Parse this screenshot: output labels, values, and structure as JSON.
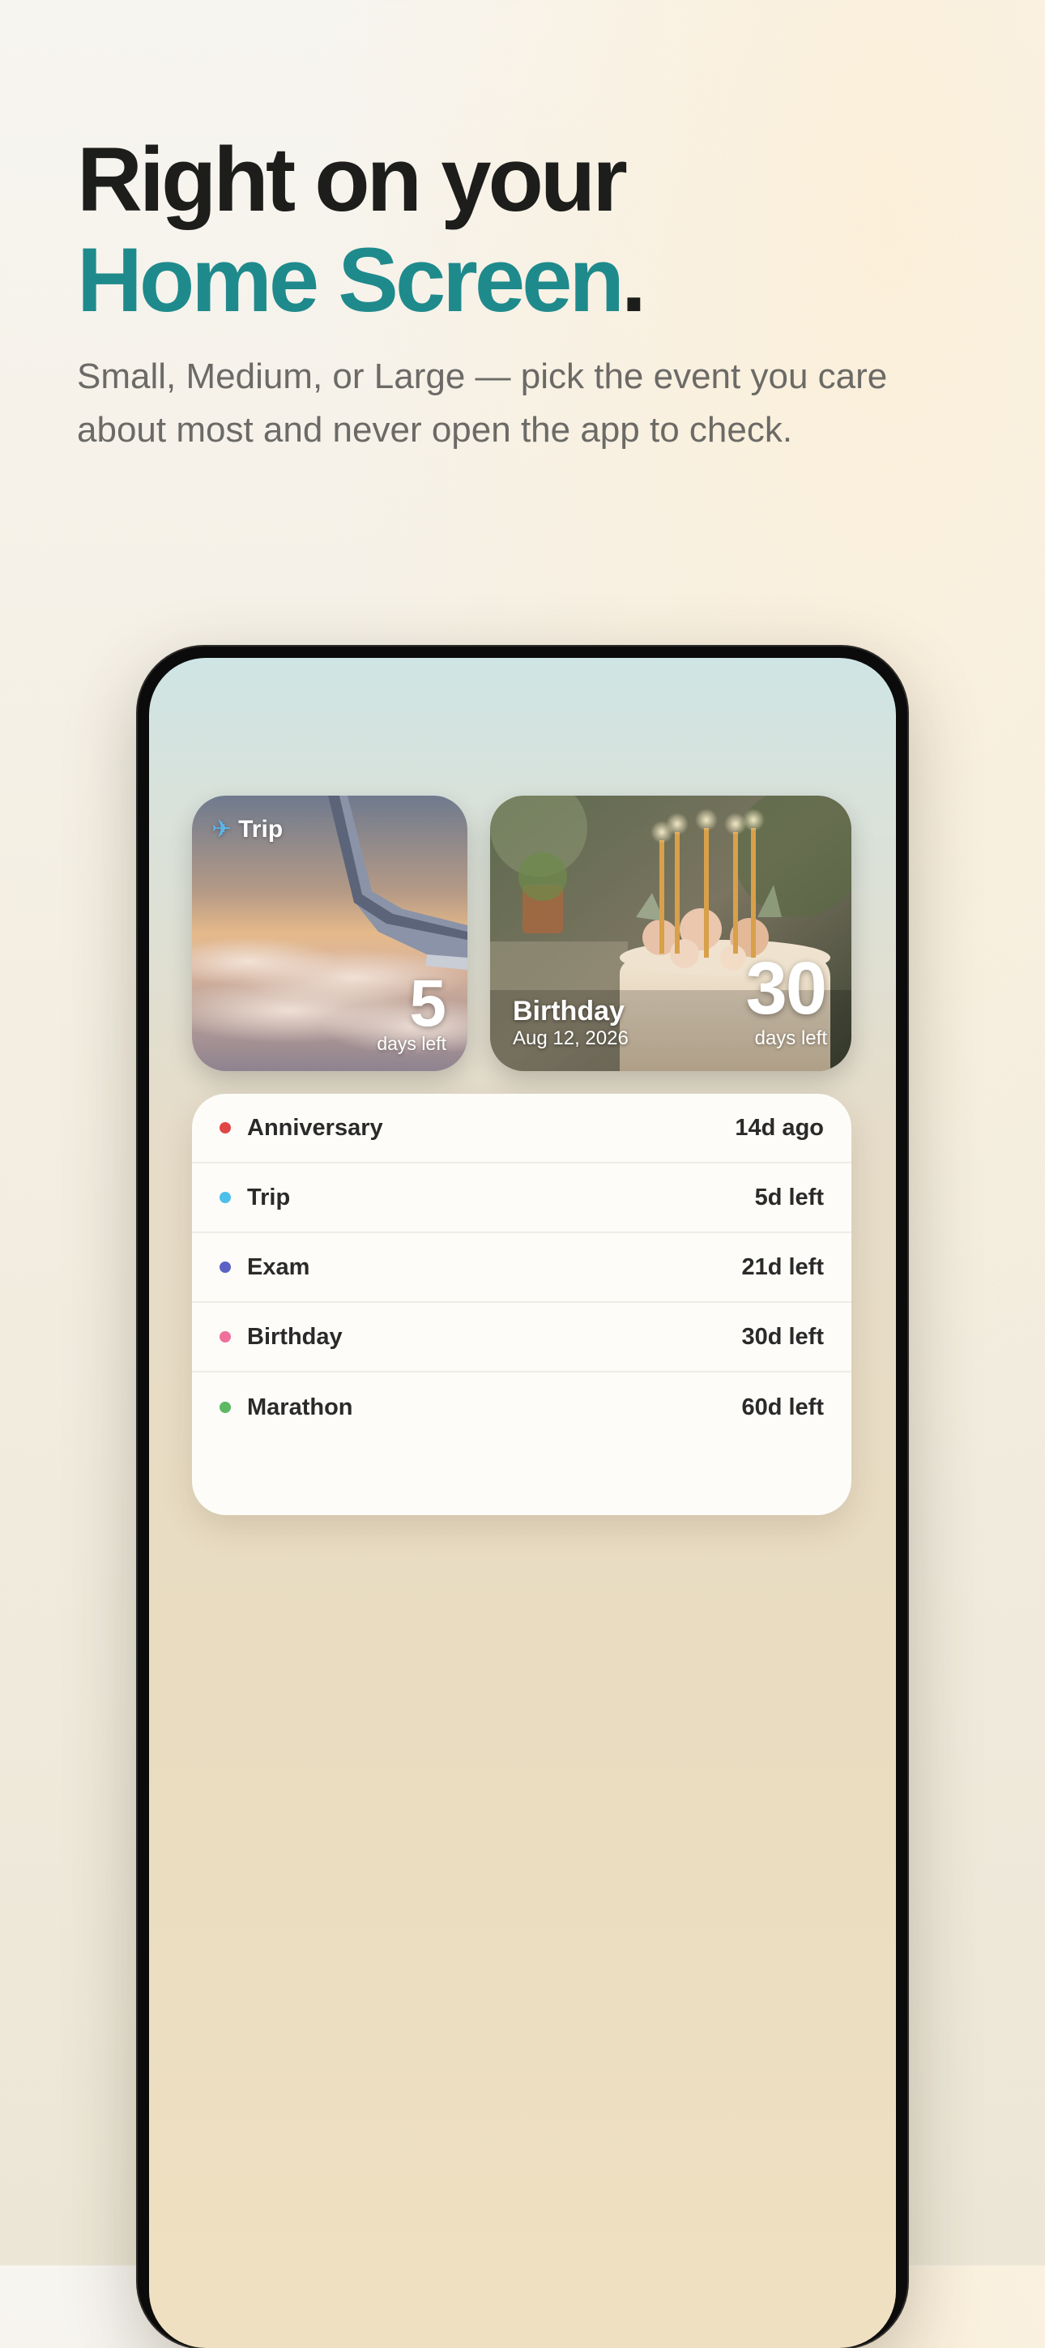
{
  "header": {
    "headline_line1": "Right on your",
    "headline_accent": "Home Screen",
    "headline_period": ".",
    "subtitle": "Small, Medium, or Large — pick the event you care about most and never open the app to check."
  },
  "widgets": {
    "small": {
      "label": "Trip",
      "icon": "airplane-icon",
      "count": "5",
      "unit": "days left"
    },
    "medium": {
      "title": "Birthday",
      "date": "Aug 12, 2026",
      "count": "30",
      "unit": "days left"
    },
    "large": {
      "items": [
        {
          "name": "Anniversary",
          "value": "14d ago",
          "color": "#e04646"
        },
        {
          "name": "Trip",
          "value": "5d left",
          "color": "#4dbfea"
        },
        {
          "name": "Exam",
          "value": "21d left",
          "color": "#5a63c4"
        },
        {
          "name": "Birthday",
          "value": "30d left",
          "color": "#f06f9c"
        },
        {
          "name": "Marathon",
          "value": "60d left",
          "color": "#5cb862"
        }
      ]
    }
  },
  "colors": {
    "accent": "#1f8a8c",
    "text": "#1d1d1b"
  }
}
